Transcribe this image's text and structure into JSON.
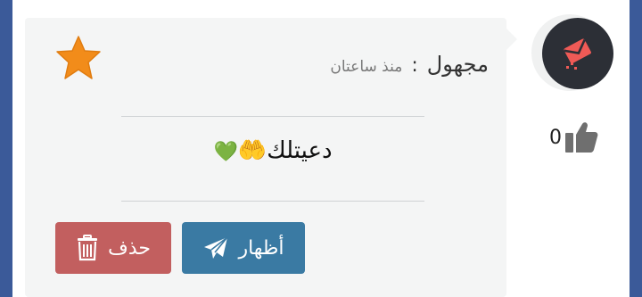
{
  "post": {
    "author": "مجهول",
    "separator": ":",
    "time": "منذ ساعتان",
    "message": "دعيتلك🤲",
    "heart": "💚"
  },
  "likes": {
    "count": "0",
    "icon": "thumbs-up-icon"
  },
  "actions": {
    "show_label": "أظهار",
    "delete_label": "حذف"
  },
  "colors": {
    "show_button": "#3a7aa3",
    "delete_button": "#c25f5f",
    "star": "#f28c1a",
    "avatar_bg": "#2c2f36",
    "avatar_icon": "#ef5a56"
  }
}
